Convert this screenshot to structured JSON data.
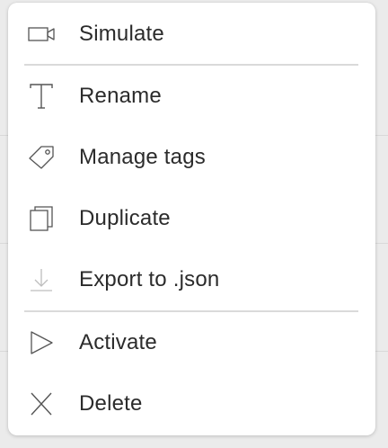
{
  "menu": {
    "items": [
      {
        "label": "Simulate",
        "icon": "video-camera-icon"
      },
      {
        "label": "Rename",
        "icon": "text-icon"
      },
      {
        "label": "Manage tags",
        "icon": "tag-icon"
      },
      {
        "label": "Duplicate",
        "icon": "duplicate-icon"
      },
      {
        "label": "Export to .json",
        "icon": "download-icon"
      },
      {
        "label": "Activate",
        "icon": "play-icon"
      },
      {
        "label": "Delete",
        "icon": "close-icon"
      }
    ]
  },
  "colors": {
    "menu_background": "#ffffff",
    "page_background": "#ebebeb",
    "text": "#2b2b2b",
    "icon": "#555555",
    "divider": "#dadada"
  }
}
